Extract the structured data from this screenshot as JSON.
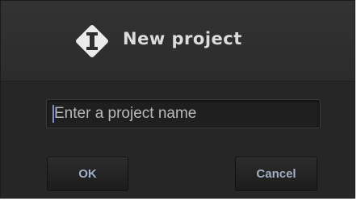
{
  "dialog": {
    "title": "New project",
    "logo_icon": "diamond-I-logo-icon"
  },
  "form": {
    "name_placeholder": "Enter a project name",
    "name_value": ""
  },
  "actions": {
    "ok_label": "OK",
    "cancel_label": "Cancel"
  },
  "colors": {
    "dialog_background": "#2a2a2a",
    "button_text": "#9fb0c6",
    "title_text": "#dcdcdc",
    "caret": "#7b8fd6"
  }
}
